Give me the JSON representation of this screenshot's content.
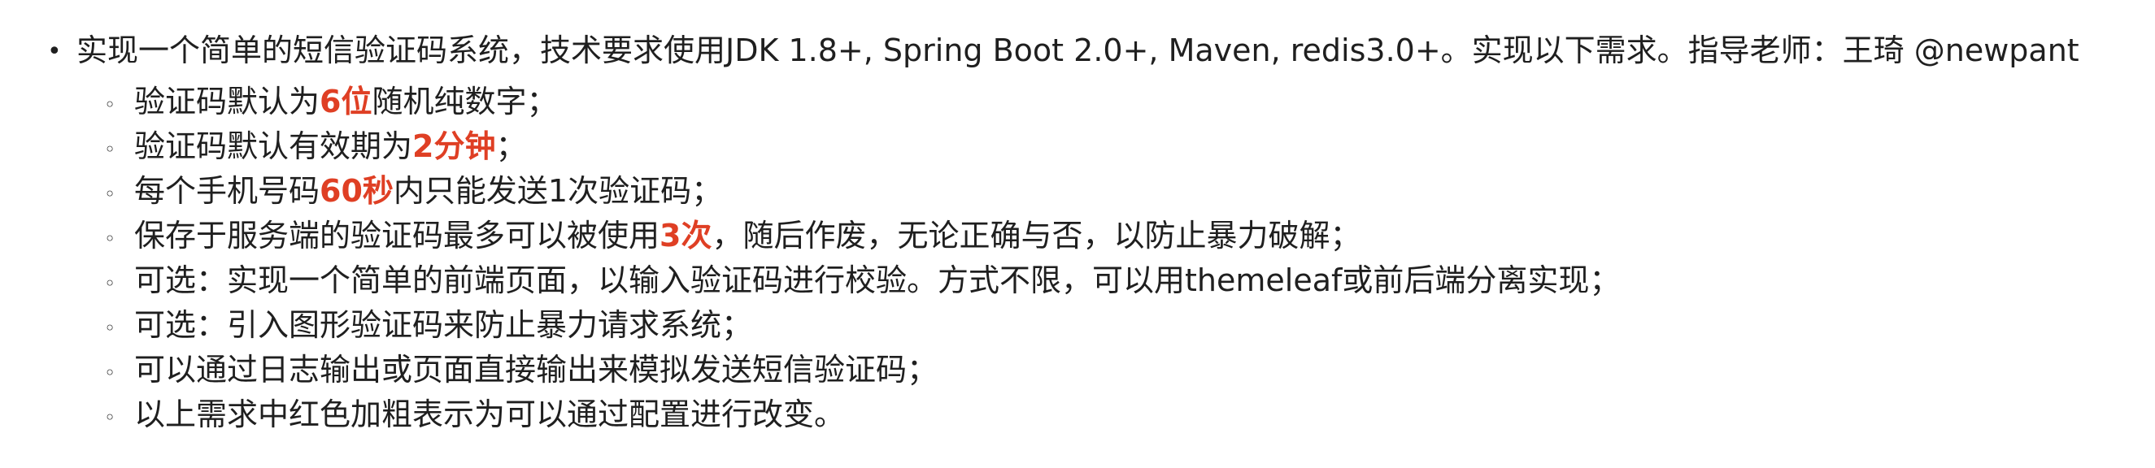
{
  "document": {
    "main_item": {
      "bullet": "•",
      "text": "实现一个简单的短信验证码系统，技术要求使用JDK 1.8+, Spring Boot 2.0+, Maven, redis3.0+。实现以下需求。指导老师：王琦 @newpant"
    },
    "sub_bullet": "◦",
    "items": [
      {
        "pre": "验证码默认为",
        "em": "6位",
        "post": "随机纯数字；"
      },
      {
        "pre": "验证码默认有效期为",
        "em": "2分钟",
        "post": "；"
      },
      {
        "pre": "每个手机号码",
        "em": "60秒",
        "post": "内只能发送1次验证码；"
      },
      {
        "pre": "保存于服务端的验证码最多可以被使用",
        "em": "3次",
        "post": "，随后作废，无论正确与否，以防止暴力破解；"
      },
      {
        "text": "可选：实现一个简单的前端页面，以输入验证码进行校验。方式不限，可以用themeleaf或前后端分离实现；"
      },
      {
        "text": "可选：引入图形验证码来防止暴力请求系统；"
      },
      {
        "text": "可以通过日志输出或页面直接输出来模拟发送短信验证码；"
      },
      {
        "text": "以上需求中红色加粗表示为可以通过配置进行改变。"
      }
    ],
    "colors": {
      "text": "#1f1f1f",
      "emphasis": "#df3f24",
      "background": "#ffffff"
    }
  }
}
